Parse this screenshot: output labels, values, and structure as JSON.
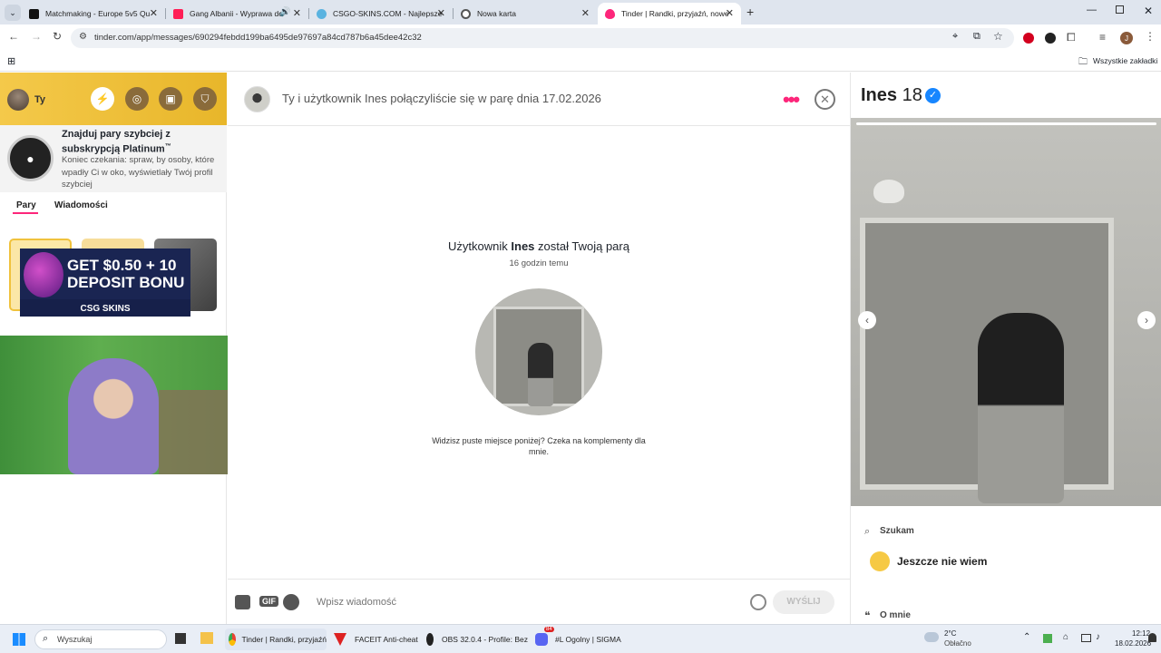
{
  "browser": {
    "tabs": [
      {
        "label": "Matchmaking - Europe 5v5 Qu",
        "color": "#111111"
      },
      {
        "label": "Gang Albanii - Wyprawa do",
        "color": "#ff1e56"
      },
      {
        "label": "CSGO-SKINS.COM - Najlepsze",
        "color": "#5ab3e0"
      },
      {
        "label": "Nowa karta",
        "color": "#555555"
      },
      {
        "label": "Tinder | Randki, przyjaźń, nowe",
        "color": "#fd267a"
      }
    ],
    "url": "tinder.com/app/messages/690294febdd199ba6495de97697a84cd787b6a45dee42c32",
    "bookmarks_label": "Wszystkie zakładki",
    "profile_initial": "J"
  },
  "sidebar": {
    "user_label": "Ty",
    "promo_title": "Znajduj pary szybciej z subskrypcją Platinum",
    "promo_tm": "™",
    "promo_body": "Koniec czekania: spraw, by osoby, które wpadły Ci w oko, wyświetlały Twój profil szybciej",
    "tab_matches": "Pary",
    "tab_messages": "Wiadomości",
    "ad_line1": "GET $0.50 + 10",
    "ad_line2": "DEPOSIT BONU",
    "ad_brand": "CSG SKINS"
  },
  "chat": {
    "header_text": "Ty i użytkownik Ines połączyliście się w parę dnia 17.02.2026",
    "match_prefix": "Użytkownik",
    "match_name": "Ines",
    "match_suffix": "został Twoją parą",
    "match_time": "16 godzin temu",
    "hint": "Widzisz puste miejsce poniżej? Czeka na komplementy dla mnie.",
    "input_placeholder": "Wpisz wiadomość",
    "gif_label": "GIF",
    "send_label": "WYŚLIJ"
  },
  "profile": {
    "name": "Ines",
    "age": "18",
    "looking_label": "Szukam",
    "looking_value": "Jeszcze nie wiem",
    "about_label": "O mnie"
  },
  "taskbar": {
    "search_placeholder": "Wyszukaj",
    "apps": [
      {
        "label": "Tinder | Randki, przyjaźń"
      },
      {
        "label": "FACEIT Anti-cheat"
      },
      {
        "label": "OBS 32.0.4 - Profile: Bez"
      },
      {
        "label": "#L  Ogolny | SIGMA"
      }
    ],
    "weather_temp": "2°C",
    "weather_desc": "Obłačno",
    "time": "12:12",
    "date": "18.02.2026",
    "discord_badge": "84"
  },
  "colors": {
    "tinder": "#fd267a",
    "verified": "#1786ff",
    "gold": "#f0c23c"
  }
}
